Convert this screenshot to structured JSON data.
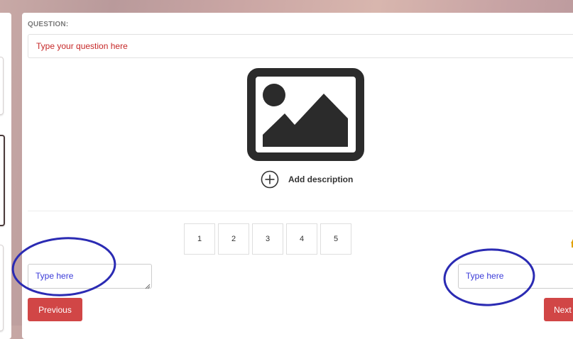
{
  "question": {
    "section_label": "QUESTION:",
    "input_placeholder": "Type your question here"
  },
  "media": {
    "icon": "image-icon",
    "add_description_label": "Add description",
    "add_icon": "circle-plus-icon"
  },
  "scale": {
    "options": [
      "1",
      "2",
      "3",
      "4",
      "5"
    ]
  },
  "labels": {
    "left_placeholder": "Type here",
    "right_placeholder": "Type here"
  },
  "navigation": {
    "previous_label": "Previous",
    "next_label": "Next"
  },
  "colors": {
    "accent_red": "#d14646",
    "placeholder_red": "#c62828",
    "placeholder_blue": "#3a3ad8",
    "annotation_blue": "#2b2bb3"
  }
}
